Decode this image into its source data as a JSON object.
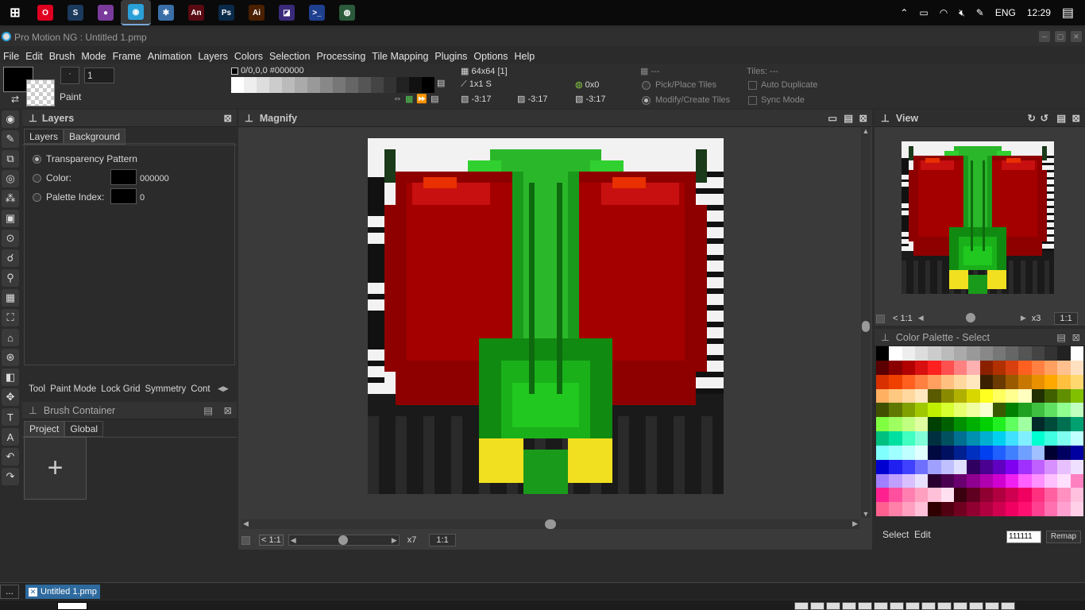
{
  "taskbar": {
    "apps": [
      {
        "name": "opera-icon",
        "label": "O",
        "color": "#e00020"
      },
      {
        "name": "steam-icon",
        "label": "S",
        "color": "#1b3a5c"
      },
      {
        "name": "app3-icon",
        "label": "●",
        "color": "#7a3b9c"
      },
      {
        "name": "pro-motion-icon",
        "label": "◉",
        "color": "#2aa0d8"
      },
      {
        "name": "app5-icon",
        "label": "✱",
        "color": "#3a6fa8"
      },
      {
        "name": "animate-icon",
        "label": "An",
        "color": "#5a0a12"
      },
      {
        "name": "photoshop-icon",
        "label": "Ps",
        "color": "#0a2a4a"
      },
      {
        "name": "illustrator-icon",
        "label": "Ai",
        "color": "#4a2000"
      },
      {
        "name": "app9-icon",
        "label": "◪",
        "color": "#3a2a7a"
      },
      {
        "name": "powershell-icon",
        "label": ">_",
        "color": "#1f3f8f"
      },
      {
        "name": "app11-icon",
        "label": "◍",
        "color": "#2a5a3a"
      }
    ],
    "tray": {
      "lang": "ENG",
      "time": "12:29"
    }
  },
  "window": {
    "title": "Pro Motion NG : Untitled 1.pmp"
  },
  "menu": [
    "File",
    "Edit",
    "Brush",
    "Mode",
    "Frame",
    "Animation",
    "Layers",
    "Colors",
    "Selection",
    "Processing",
    "Tile Mapping",
    "Plugins",
    "Options",
    "Help"
  ],
  "toolbar": {
    "brush_size": "1",
    "mode_label": "Paint",
    "color_readout": "0/0,0,0 #000000",
    "canvas_size": "64x64 [1]",
    "brush_readout": "1x1 S",
    "coord1": "-3:17",
    "coord2": "-3:17",
    "coord3": "-3:17",
    "hex_readout": "0x0",
    "tile_readout": "---",
    "tiles_label": "Tiles: ---",
    "pick_place": "Pick/Place Tiles",
    "modify_create": "Modify/Create Tiles",
    "auto_duplicate": "Auto Duplicate",
    "sync_mode": "Sync Mode"
  },
  "layers": {
    "title": "Layers",
    "tabs": [
      "Layers",
      "Background"
    ],
    "transparency": "Transparency Pattern",
    "color_label": "Color:",
    "color_value": "000000",
    "palette_label": "Palette Index:",
    "palette_value": "0",
    "bottom_tabs": [
      "Tool",
      "Paint Mode",
      "Lock Grid",
      "Symmetry",
      "Cont"
    ]
  },
  "brush_container": {
    "title": "Brush Container",
    "tabs": [
      "Project",
      "Global"
    ],
    "add": "+"
  },
  "magnify": {
    "title": "Magnify",
    "zoom_label": "< 1:1",
    "zoom_x": "x7",
    "ratio": "1:1"
  },
  "view": {
    "title": "View",
    "zoom_label": "< 1:1",
    "zoom_x": "x3",
    "ratio": "1:1"
  },
  "palette": {
    "title": "Color Palette - Select",
    "select": "Select",
    "edit": "Edit",
    "hex": "111111",
    "remap": "Remap"
  },
  "status": {
    "dots": "...",
    "file_tab": "Untitled 1.pmp"
  },
  "colors": {
    "accent": "#3a8fd8",
    "panel": "#2b2b2b",
    "canvas_bg": "#3a3a3a"
  }
}
